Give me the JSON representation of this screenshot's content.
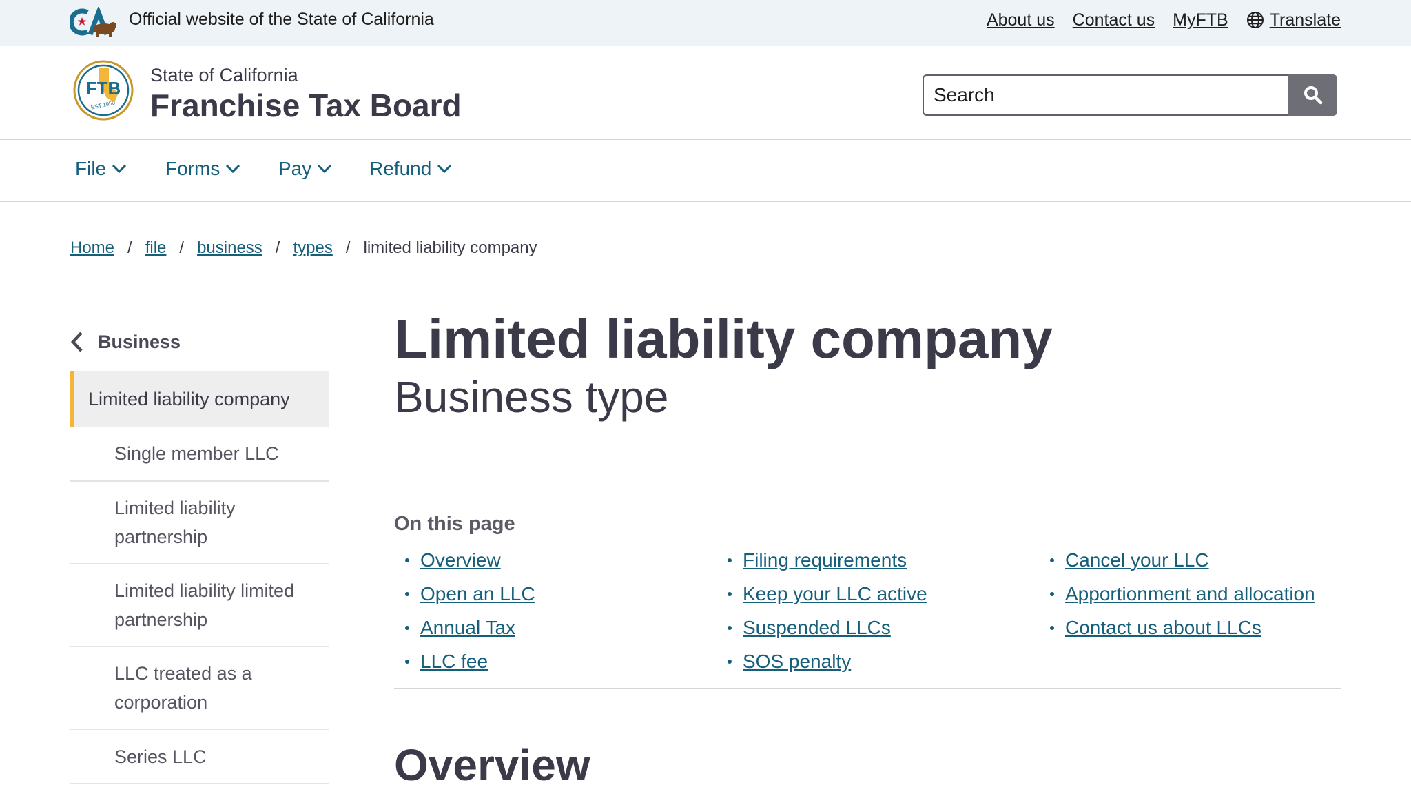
{
  "utility": {
    "official_text": "Official website of the State of California",
    "links": {
      "about": "About us",
      "contact": "Contact us",
      "myftb": "MyFTB",
      "translate": "Translate"
    }
  },
  "header": {
    "state": "State of California",
    "agency": "Franchise Tax Board",
    "search_placeholder": "Search"
  },
  "nav": {
    "items": [
      "File",
      "Forms",
      "Pay",
      "Refund"
    ]
  },
  "breadcrumb": {
    "links": [
      "Home",
      "file",
      "business",
      "types"
    ],
    "current": "limited liability company"
  },
  "sidenav": {
    "back": "Business",
    "active": "Limited liability company",
    "items": [
      "Single member LLC",
      "Limited liability partnership",
      "Limited liability limited partnership",
      "LLC treated as a corporation",
      "Series LLC"
    ]
  },
  "main": {
    "title": "Limited liability company",
    "subtitle": "Business type",
    "on_this_page": {
      "heading": "On this page",
      "columns": [
        [
          "Overview",
          "Open an LLC",
          "Annual Tax",
          "LLC fee"
        ],
        [
          "Filing requirements",
          "Keep your LLC active",
          "Suspended LLCs",
          "SOS penalty"
        ],
        [
          "Cancel your LLC",
          "Apportionment and allocation",
          "Contact us about LLCs"
        ]
      ]
    },
    "section_heading": "Overview"
  },
  "colors": {
    "link": "#165f7b",
    "text": "#3b3a48",
    "utility_bg": "#eef3f7",
    "active_accent": "#f2b738",
    "search_button": "#6e6e77"
  },
  "icons": {
    "ca_logo": "ca-logo-icon",
    "seal": "ftb-seal-icon",
    "globe": "globe-icon",
    "search": "search-icon",
    "chevron_down": "chevron-down-icon",
    "chevron_left": "chevron-left-icon"
  }
}
